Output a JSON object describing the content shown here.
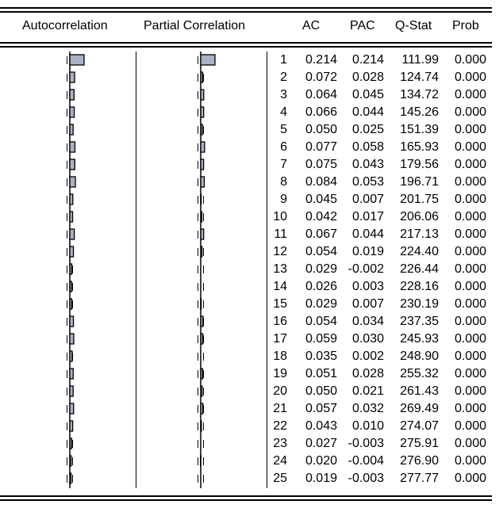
{
  "chart_data": {
    "type": "table",
    "columns": {
      "autocorrelation": "Autocorrelation",
      "partial_correlation": "Partial Correlation",
      "ac": "AC",
      "pac": "PAC",
      "qstat": "Q-Stat",
      "prob": "Prob"
    },
    "bar_color": "#a9b0c8",
    "rows": [
      {
        "lag": "1",
        "ac": "0.214",
        "pac": "0.214",
        "q": "111.99",
        "p": "0.000"
      },
      {
        "lag": "2",
        "ac": "0.072",
        "pac": "0.028",
        "q": "124.74",
        "p": "0.000"
      },
      {
        "lag": "3",
        "ac": "0.064",
        "pac": "0.045",
        "q": "134.72",
        "p": "0.000"
      },
      {
        "lag": "4",
        "ac": "0.066",
        "pac": "0.044",
        "q": "145.26",
        "p": "0.000"
      },
      {
        "lag": "5",
        "ac": "0.050",
        "pac": "0.025",
        "q": "151.39",
        "p": "0.000"
      },
      {
        "lag": "6",
        "ac": "0.077",
        "pac": "0.058",
        "q": "165.93",
        "p": "0.000"
      },
      {
        "lag": "7",
        "ac": "0.075",
        "pac": "0.043",
        "q": "179.56",
        "p": "0.000"
      },
      {
        "lag": "8",
        "ac": "0.084",
        "pac": "0.053",
        "q": "196.71",
        "p": "0.000"
      },
      {
        "lag": "9",
        "ac": "0.045",
        "pac": "0.007",
        "q": "201.75",
        "p": "0.000"
      },
      {
        "lag": "10",
        "ac": "0.042",
        "pac": "0.017",
        "q": "206.06",
        "p": "0.000"
      },
      {
        "lag": "11",
        "ac": "0.067",
        "pac": "0.044",
        "q": "217.13",
        "p": "0.000"
      },
      {
        "lag": "12",
        "ac": "0.054",
        "pac": "0.019",
        "q": "224.40",
        "p": "0.000"
      },
      {
        "lag": "13",
        "ac": "0.029",
        "pac": "-0.002",
        "q": "226.44",
        "p": "0.000"
      },
      {
        "lag": "14",
        "ac": "0.026",
        "pac": "0.003",
        "q": "228.16",
        "p": "0.000"
      },
      {
        "lag": "15",
        "ac": "0.029",
        "pac": "0.007",
        "q": "230.19",
        "p": "0.000"
      },
      {
        "lag": "16",
        "ac": "0.054",
        "pac": "0.034",
        "q": "237.35",
        "p": "0.000"
      },
      {
        "lag": "17",
        "ac": "0.059",
        "pac": "0.030",
        "q": "245.93",
        "p": "0.000"
      },
      {
        "lag": "18",
        "ac": "0.035",
        "pac": "0.002",
        "q": "248.90",
        "p": "0.000"
      },
      {
        "lag": "19",
        "ac": "0.051",
        "pac": "0.028",
        "q": "255.32",
        "p": "0.000"
      },
      {
        "lag": "20",
        "ac": "0.050",
        "pac": "0.021",
        "q": "261.43",
        "p": "0.000"
      },
      {
        "lag": "21",
        "ac": "0.057",
        "pac": "0.032",
        "q": "269.49",
        "p": "0.000"
      },
      {
        "lag": "22",
        "ac": "0.043",
        "pac": "0.010",
        "q": "274.07",
        "p": "0.000"
      },
      {
        "lag": "23",
        "ac": "0.027",
        "pac": "-0.003",
        "q": "275.91",
        "p": "0.000"
      },
      {
        "lag": "24",
        "ac": "0.020",
        "pac": "-0.004",
        "q": "276.90",
        "p": "0.000"
      },
      {
        "lag": "25",
        "ac": "0.019",
        "pac": "-0.003",
        "q": "277.77",
        "p": "0.000"
      }
    ]
  }
}
